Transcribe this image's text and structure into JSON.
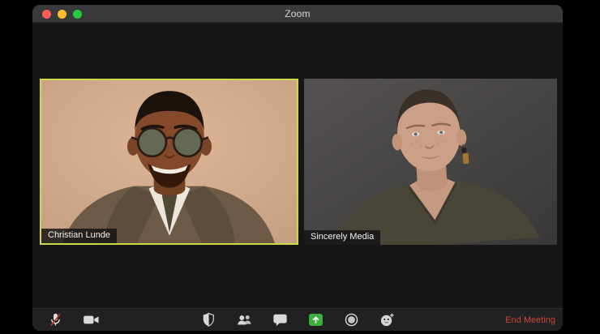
{
  "window": {
    "title": "Zoom",
    "traffic_lights": [
      "close",
      "minimize",
      "fullscreen"
    ]
  },
  "participants": [
    {
      "name": "Christian Lunde",
      "active_speaker": true
    },
    {
      "name": "Sincerely Media",
      "active_speaker": false
    }
  ],
  "toolbar": {
    "buttons": [
      {
        "id": "mute",
        "icon": "microphone-muted-icon",
        "state": "muted"
      },
      {
        "id": "video",
        "icon": "video-camera-icon",
        "state": "on"
      },
      {
        "id": "security",
        "icon": "shield-icon"
      },
      {
        "id": "participants",
        "icon": "participants-icon"
      },
      {
        "id": "chat",
        "icon": "chat-bubble-icon"
      },
      {
        "id": "share-screen",
        "icon": "share-screen-icon",
        "highlight": "green"
      },
      {
        "id": "record",
        "icon": "record-icon"
      },
      {
        "id": "reactions",
        "icon": "reactions-smiley-icon"
      }
    ],
    "end_meeting_label": "End Meeting"
  },
  "colors": {
    "window-bg": "#161617",
    "titlebar-bg": "#3a3a3c",
    "toolbar-bg": "#212123",
    "active-speaker-border": "#cdd94b",
    "share-green": "#3eae41",
    "end-red": "#c9473d",
    "traffic-red": "#ff5f57",
    "traffic-yellow": "#febc2e",
    "traffic-green": "#28c840",
    "icon-gray": "#d8d6d4"
  }
}
